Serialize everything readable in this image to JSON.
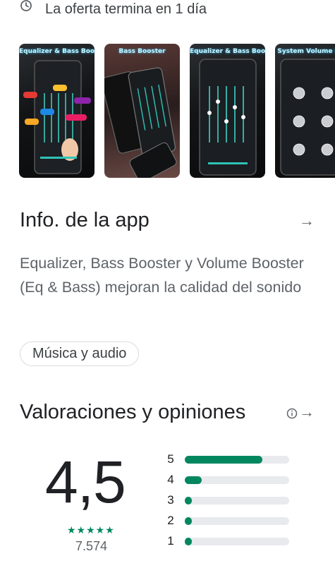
{
  "offer": {
    "text": "La oferta termina en 1 día",
    "icon": "clock-icon"
  },
  "screenshots": [
    {
      "caption": "Equalizer & Bass Booster",
      "theme": "eq-genres"
    },
    {
      "caption": "Bass Booster",
      "theme": "phones"
    },
    {
      "caption": "Equalizer & Bass Booster",
      "theme": "eq-sliders"
    },
    {
      "caption": "System Volume boo",
      "theme": "knobs"
    }
  ],
  "app_info": {
    "title": "Info. de la app",
    "description": "Equalizer, Bass Booster y Volume Booster (Eq & Bass) mejoran la calidad del sonido",
    "category_chip": "Música y audio"
  },
  "ratings": {
    "title": "Valoraciones y opiniones",
    "average": "4,5",
    "stars": "★★★★★",
    "count": "7.574",
    "accent": "#01875f",
    "track": "#e8eaed",
    "distribution": [
      {
        "label": "5",
        "fraction": 0.74
      },
      {
        "label": "4",
        "fraction": 0.16
      },
      {
        "label": "3",
        "fraction": 0.06
      },
      {
        "label": "2",
        "fraction": 0.06
      },
      {
        "label": "1",
        "fraction": 0.06
      }
    ]
  }
}
